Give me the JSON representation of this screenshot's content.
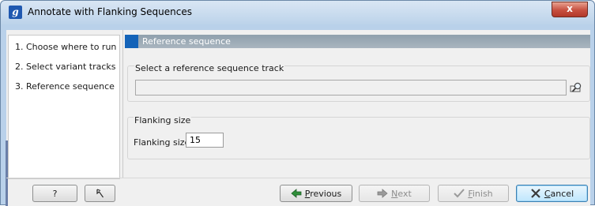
{
  "window": {
    "title": "Annotate with Flanking Sequences",
    "app_icon_letter": "g",
    "close_glyph": "x"
  },
  "steps": [
    {
      "label": "1.  Choose where to run"
    },
    {
      "label": "2.  Select variant tracks"
    },
    {
      "label": "3.  Reference sequence"
    }
  ],
  "panel": {
    "header": "Reference sequence",
    "reference_group_label": "Select a reference sequence track",
    "track_value": "",
    "flanking_group_label": "Flanking size",
    "flanking_field_label": "Flanking size",
    "flanking_value": "15"
  },
  "buttons": {
    "help": "?",
    "reset_icon": "reset-arrow-icon",
    "previous_first": "P",
    "previous_rest": "revious",
    "next_first": "N",
    "next_rest": "ext",
    "finish_first": "F",
    "finish_rest": "inish",
    "cancel_first": "C",
    "cancel_rest": "ancel"
  }
}
